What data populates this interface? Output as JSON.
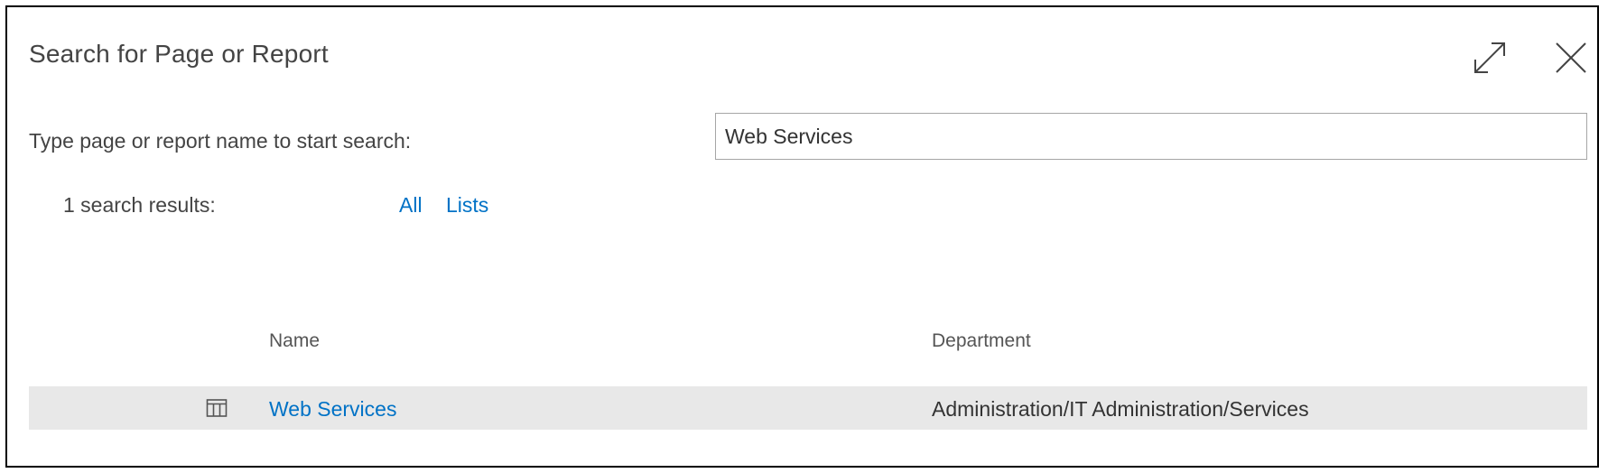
{
  "dialog": {
    "title": "Search for Page or Report",
    "expand_icon": "expand-arrows-icon",
    "close_icon": "close-icon"
  },
  "search": {
    "label": "Type page or report name to start search:",
    "value": "Web Services",
    "placeholder": ""
  },
  "results": {
    "count_text": "1 search results:",
    "filters": [
      "All",
      "Lists"
    ]
  },
  "table": {
    "columns": [
      "Name",
      "Department"
    ],
    "rows": [
      {
        "icon": "list-table-icon",
        "name": "Web Services",
        "department": "Administration/IT Administration/Services"
      }
    ]
  },
  "colors": {
    "link": "#0072c6",
    "row_highlight": "#e8e8e8",
    "border": "#000000"
  }
}
